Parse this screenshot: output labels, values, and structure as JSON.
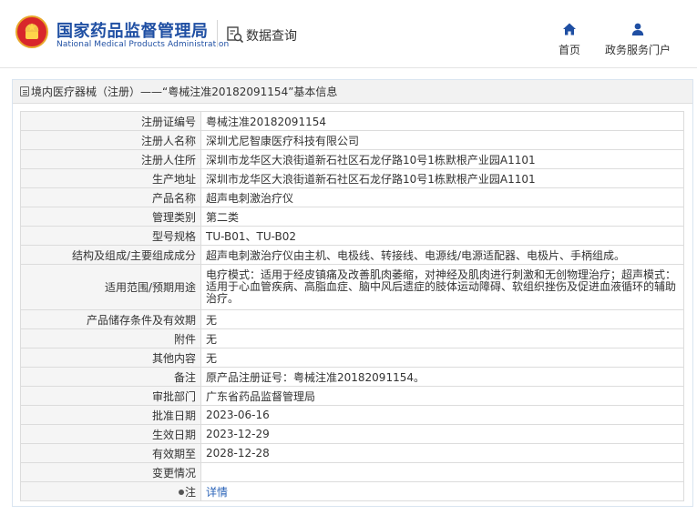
{
  "header": {
    "site_name_cn": "国家药品监督管理局",
    "site_name_en": "National Medical Products Administration",
    "query_label": "数据查询",
    "nav": [
      {
        "label": "首页",
        "icon": "home-icon"
      },
      {
        "label": "政务服务门户",
        "icon": "user-icon"
      }
    ]
  },
  "panel": {
    "title": "境内医疗器械（注册）——“粤械注准20182091154”基本信息"
  },
  "records": [
    {
      "label": "注册证编号",
      "value": "粤械注准20182091154"
    },
    {
      "label": "注册人名称",
      "value": "深圳尤尼智康医疗科技有限公司"
    },
    {
      "label": "注册人住所",
      "value": "深圳市龙华区大浪街道新石社区石龙仔路10号1栋默根产业园A1101"
    },
    {
      "label": "生产地址",
      "value": "深圳市龙华区大浪街道新石社区石龙仔路10号1栋默根产业园A1101"
    },
    {
      "label": "产品名称",
      "value": "超声电刺激治疗仪"
    },
    {
      "label": "管理类别",
      "value": "第二类"
    },
    {
      "label": "型号规格",
      "value": "TU-B01、TU-B02"
    },
    {
      "label": "结构及组成/主要组成成分",
      "value": "超声电刺激治疗仪由主机、电极线、转接线、电源线/电源适配器、电极片、手柄组成。"
    },
    {
      "label": "适用范围/预期用途",
      "value": "电疗模式：适用于经皮镇痛及改善肌肉萎缩，对神经及肌肉进行刺激和无创物理治疗；超声模式：适用于心血管疾病、高脂血症、脑中风后遗症的肢体运动障碍、软组织挫伤及促进血液循环的辅助治疗。"
    },
    {
      "label": "产品储存条件及有效期",
      "value": "无"
    },
    {
      "label": "附件",
      "value": "无"
    },
    {
      "label": "其他内容",
      "value": "无"
    },
    {
      "label": "备注",
      "value": "原产品注册证号：粤械注准20182091154。"
    },
    {
      "label": "审批部门",
      "value": "广东省药品监督管理局"
    },
    {
      "label": "批准日期",
      "value": "2023-06-16"
    },
    {
      "label": "生效日期",
      "value": "2023-12-29"
    },
    {
      "label": "有效期至",
      "value": "2028-12-28"
    },
    {
      "label": "变更情况",
      "value": ""
    },
    {
      "label": "注",
      "value": "详情"
    }
  ]
}
